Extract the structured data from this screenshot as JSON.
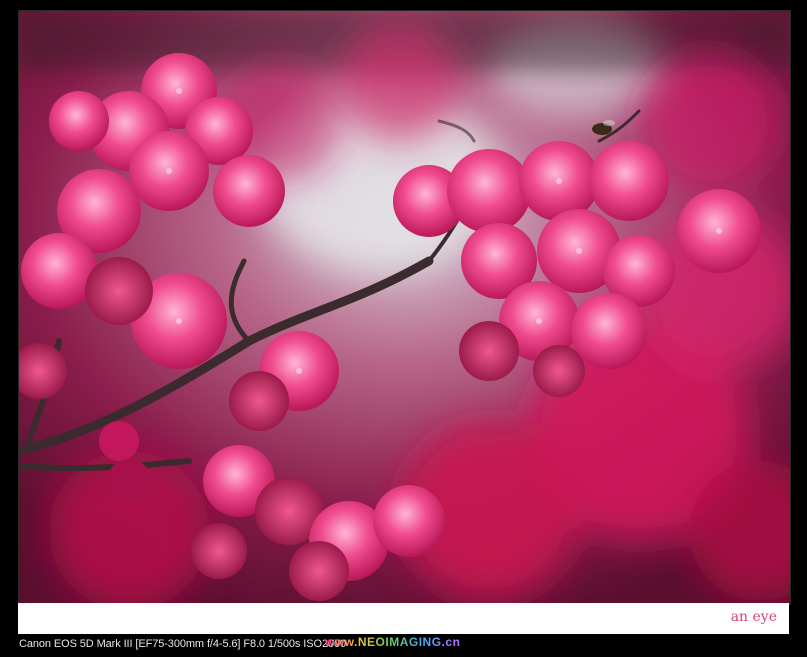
{
  "photo": {
    "subject": "pink-cherry-blossoms",
    "colors": {
      "blossom": "#d81b60",
      "blossom_light": "#f06292",
      "blossom_dark": "#8e1444",
      "branch": "#3a2a2a",
      "background_grey": "#cfcfd6"
    }
  },
  "caption": {
    "title": "an eye"
  },
  "footer": {
    "exif": "Canon EOS 5D Mark III [EF75-300mm f/4-5.6] F8.0 1/500s ISO2000",
    "watermark": "www.NEOIMAGING.cn"
  }
}
